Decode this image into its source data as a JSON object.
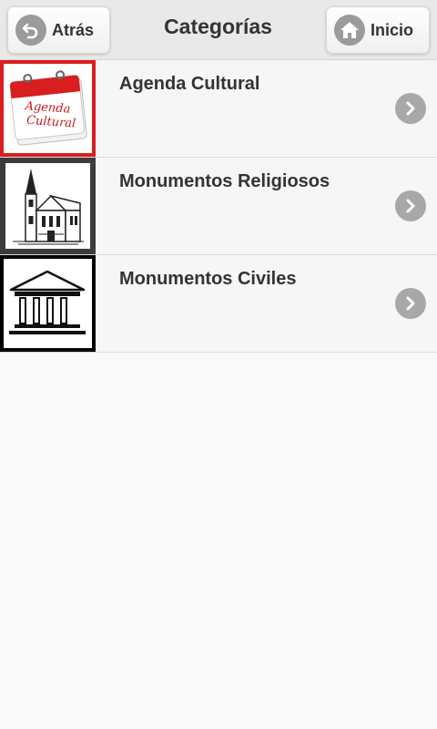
{
  "header": {
    "title": "Categorías",
    "back_label": "Atrás",
    "home_label": "Inicio"
  },
  "categories": [
    {
      "label": "Agenda Cultural",
      "icon": "calendar-icon",
      "thumb_text_1": "Agenda",
      "thumb_text_2": "Cultural",
      "border_color": "#d81e1e"
    },
    {
      "label": "Monumentos Religiosos",
      "icon": "church-icon",
      "border_color": "#3c3c3c"
    },
    {
      "label": "Monumentos Civiles",
      "icon": "columns-building-icon",
      "border_color": "#000000"
    }
  ],
  "colors": {
    "header_bg": "#e9e9e9",
    "list_bg": "#f6f6f6",
    "icon_grey": "#a8a8a8",
    "text": "#333333"
  }
}
